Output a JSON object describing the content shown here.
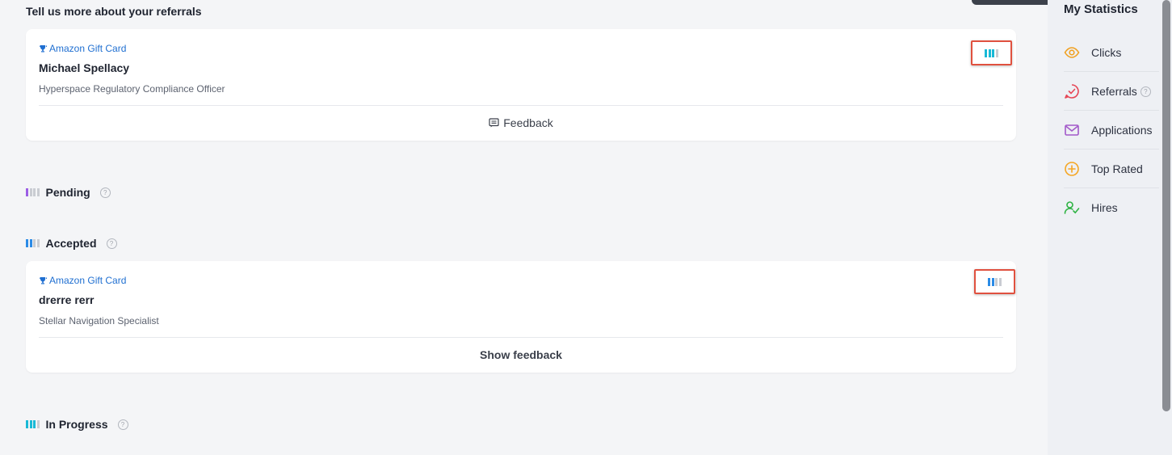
{
  "header": {
    "title": "Tell us more about your referrals"
  },
  "cards": [
    {
      "reward": "Amazon Gift Card",
      "name": "Michael Spellacy",
      "role": "Hyperspace Regulatory Compliance Officer",
      "action": "Feedback",
      "status_level": 3,
      "status_color": "#19b9d6"
    },
    {
      "reward": "Amazon Gift Card",
      "name": "drerre rerr",
      "role": "Stellar Navigation Specialist",
      "action": "Show feedback",
      "status_level": 2,
      "status_color": "#2b8be6"
    }
  ],
  "sections": {
    "pending": {
      "label": "Pending",
      "level": 1,
      "color": "#9b5de5"
    },
    "accepted": {
      "label": "Accepted",
      "level": 2,
      "color": "#2b8be6"
    },
    "in_progress": {
      "label": "In Progress",
      "level": 3,
      "color": "#19b9d6"
    }
  },
  "sidebar": {
    "title": "My Statistics",
    "items": [
      {
        "label": "Clicks",
        "icon": "eye-icon",
        "color": "#f0a020"
      },
      {
        "label": "Referrals",
        "icon": "check-circle-icon",
        "color": "#e64656"
      },
      {
        "label": "Applications",
        "icon": "envelope-icon",
        "color": "#a259c9"
      },
      {
        "label": "Top Rated",
        "icon": "plus-circle-icon",
        "color": "#f5a623"
      },
      {
        "label": "Hires",
        "icon": "user-check-icon",
        "color": "#2fb344"
      }
    ]
  },
  "help_glyph": "?"
}
